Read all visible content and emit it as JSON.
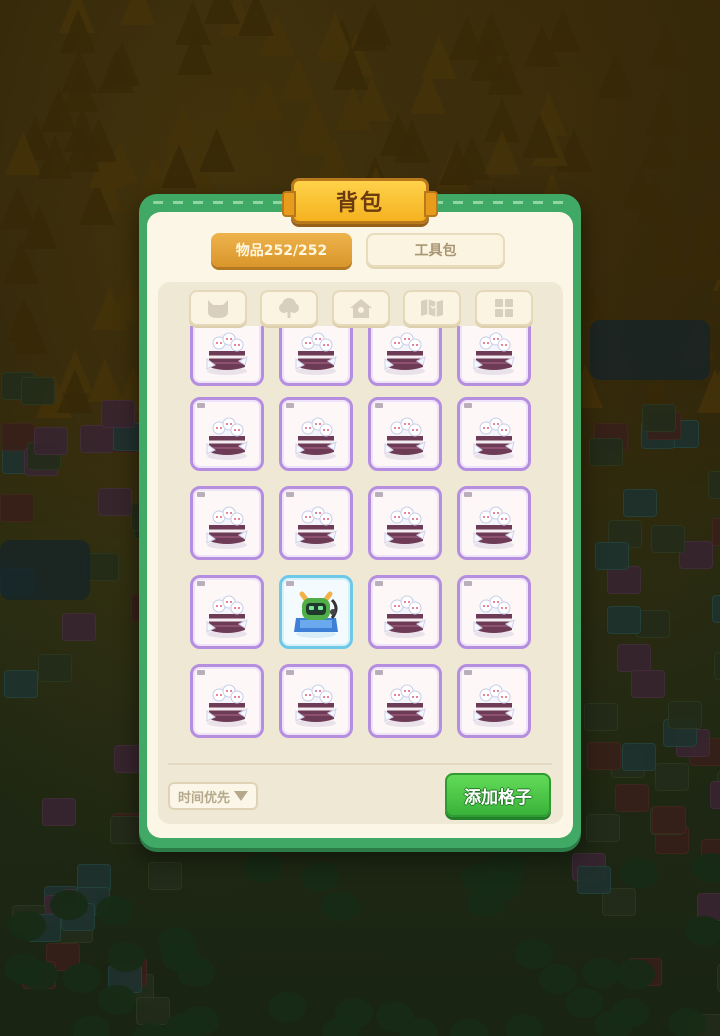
{
  "panel": {
    "title": "背包",
    "tabs": [
      {
        "label": "物品252/252",
        "active": true
      },
      {
        "label": "工具包",
        "active": false
      }
    ],
    "filters": [
      {
        "icon": "cat-icon"
      },
      {
        "icon": "tree-icon"
      },
      {
        "icon": "house-icon"
      },
      {
        "icon": "map-icon"
      },
      {
        "icon": "grid-icon"
      }
    ],
    "items": [
      "cake-item",
      "cake-item",
      "cake-item",
      "cake-item",
      "cake-item",
      "cake-item",
      "cake-item",
      "cake-item",
      "cake-item",
      "cake-item",
      "cake-item",
      "cake-item",
      "cake-item",
      "robot-cat-item",
      "cake-item",
      "cake-item",
      "cake-item",
      "cake-item",
      "cake-item",
      "cake-item"
    ],
    "sort_label": "时间优先",
    "add_label": "添加格子"
  },
  "colors": {
    "frame": "#3fa965",
    "title_bg": "#f5b21f",
    "active_tab": "#d9962b",
    "slot_border": "#b58ee0",
    "rare_border": "#6ec8e8",
    "add_button": "#39b33a"
  }
}
